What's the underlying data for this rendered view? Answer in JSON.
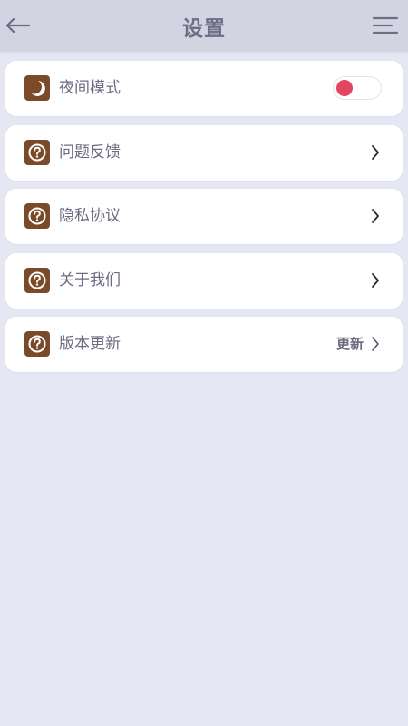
{
  "header": {
    "title": "设置",
    "back_icon": "arrow-left-icon",
    "menu_icon": "menu-lines-icon"
  },
  "settings": {
    "items": [
      {
        "label": "夜间模式",
        "icon": "moon-icon",
        "control": "toggle",
        "toggle_on": false,
        "toggle_knob_color": "#e34560"
      },
      {
        "label": "问题反馈",
        "icon": "question-icon",
        "control": "chevron"
      },
      {
        "label": "隐私协议",
        "icon": "question-icon",
        "control": "chevron"
      },
      {
        "label": "关于我们",
        "icon": "question-icon",
        "control": "chevron"
      },
      {
        "label": "版本更新",
        "icon": "question-icon",
        "control": "chevron",
        "extra": "更新"
      }
    ]
  },
  "colors": {
    "background": "#e6e7f5",
    "header_bg": "#d3d4e2",
    "title": "#6f6d86",
    "icon_bg": "#7b4a28",
    "card_bg": "#ffffff",
    "text": "#6c6b80"
  }
}
